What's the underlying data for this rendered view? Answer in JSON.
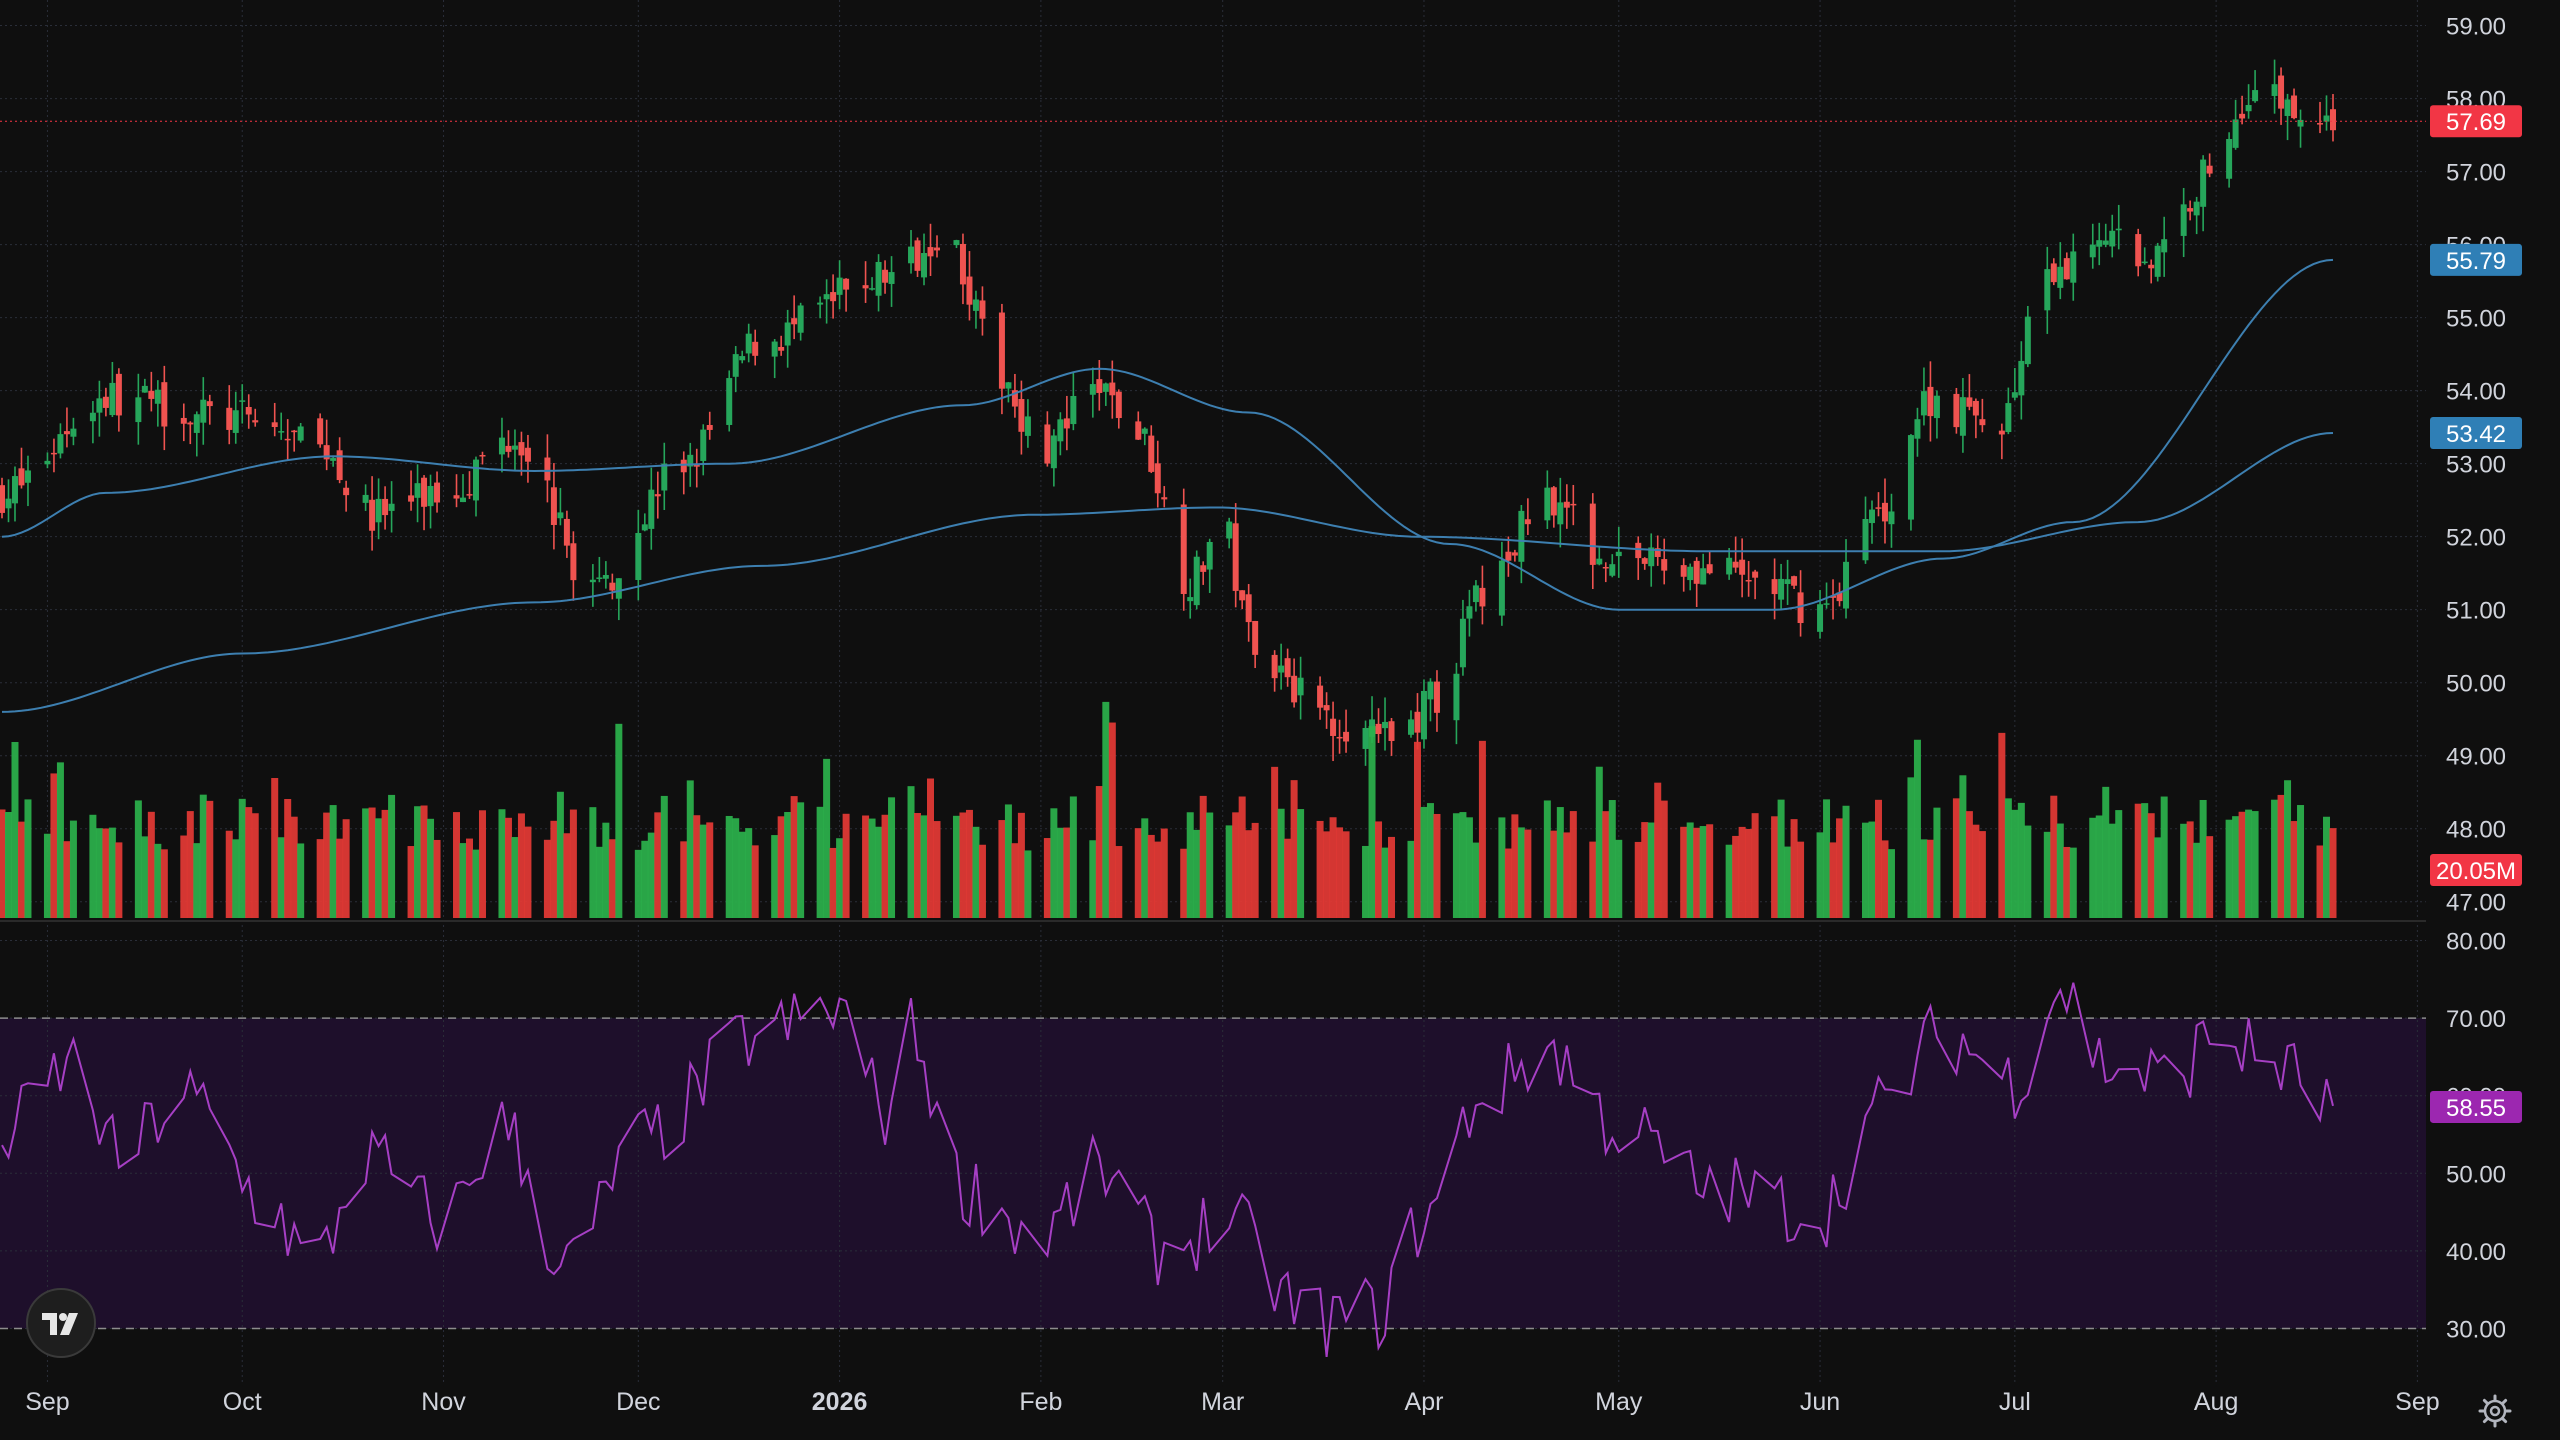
{
  "colors": {
    "background": "#0f0f0f",
    "grid": "#2a2e39",
    "up": "#26a65b",
    "down": "#ef5350",
    "upVolume": "#2bb24c",
    "downVolume": "#e53935",
    "ma": "#3d7fb0",
    "rsi": "#a63fc4",
    "rsiBand": "#1e0f2b",
    "lastPrice": "#f23645",
    "maLabel": "#2f7fb6",
    "rsiLabel": "#9c27b0"
  },
  "icons": {
    "logo": "tradingview-logo-icon",
    "settings": "gear-icon"
  },
  "chart_data": {
    "type": "candlestick",
    "priceAxis": {
      "ticks": [
        "59.00",
        "58.00",
        "57.00",
        "56.00",
        "55.00",
        "54.00",
        "53.00",
        "52.00",
        "51.00",
        "50.00",
        "49.00",
        "48.00",
        "47.00"
      ],
      "range": [
        46.75,
        59.35
      ]
    },
    "rsiAxis": {
      "ticks": [
        "80.00",
        "70.00",
        "60.00",
        "50.00",
        "40.00",
        "30.00"
      ],
      "range": [
        24,
        82
      ],
      "bands": [
        30,
        70
      ]
    },
    "timeAxis": {
      "labels": [
        "Sep",
        "Oct",
        "Nov",
        "Dec",
        "2026",
        "Feb",
        "Mar",
        "Apr",
        "May",
        "Jun",
        "Jul",
        "Aug",
        "Sep"
      ],
      "boldLabel": "2026"
    },
    "priceLabels": {
      "last": "57.69",
      "ma50": "55.79",
      "ma200": "53.42",
      "volume": "20.05M",
      "rsi": "58.55"
    },
    "lastPrice": 57.69,
    "volumeRange": [
      0,
      40
    ],
    "keyPoints": [
      [
        "2025-08-25",
        52.6
      ],
      [
        "2025-09-10",
        53.9
      ],
      [
        "2025-10-01",
        53.6
      ],
      [
        "2025-10-14",
        53.2
      ],
      [
        "2025-10-20",
        52.3
      ],
      [
        "2025-11-01",
        52.6
      ],
      [
        "2025-11-12",
        53.4
      ],
      [
        "2025-11-24",
        51.3
      ],
      [
        "2025-12-08",
        53.0
      ],
      [
        "2025-12-20",
        54.7
      ],
      [
        "2026-01-09",
        55.6
      ],
      [
        "2026-01-17",
        56.2
      ],
      [
        "2026-01-26",
        54.2
      ],
      [
        "2026-02-01",
        53.2
      ],
      [
        "2026-02-10",
        54.0
      ],
      [
        "2026-02-16",
        53.4
      ],
      [
        "2026-02-24",
        51.4
      ],
      [
        "2026-03-01",
        52.2
      ],
      [
        "2026-03-05",
        50.7
      ],
      [
        "2026-03-10",
        50.2
      ],
      [
        "2026-03-15",
        49.6
      ],
      [
        "2026-03-27",
        49.2
      ],
      [
        "2026-04-03",
        49.8
      ],
      [
        "2026-04-10",
        51.2
      ],
      [
        "2026-04-20",
        52.6
      ],
      [
        "2026-04-28",
        51.8
      ],
      [
        "2026-05-10",
        51.6
      ],
      [
        "2026-05-22",
        51.4
      ],
      [
        "2026-06-01",
        51.0
      ],
      [
        "2026-06-10",
        52.3
      ],
      [
        "2026-06-18",
        53.9
      ],
      [
        "2026-06-28",
        53.5
      ],
      [
        "2026-07-06",
        55.4
      ],
      [
        "2026-07-14",
        56.2
      ],
      [
        "2026-07-22",
        55.8
      ],
      [
        "2026-08-01",
        57.1
      ],
      [
        "2026-08-06",
        58.1
      ],
      [
        "2026-08-19",
        57.69
      ]
    ],
    "ma50Points": [
      [
        "2025-08-25",
        52.0
      ],
      [
        "2025-09-10",
        52.6
      ],
      [
        "2025-10-15",
        53.1
      ],
      [
        "2025-11-15",
        52.9
      ],
      [
        "2025-12-15",
        53.0
      ],
      [
        "2026-01-20",
        53.8
      ],
      [
        "2026-02-10",
        54.3
      ],
      [
        "2026-03-05",
        53.7
      ],
      [
        "2026-04-05",
        51.9
      ],
      [
        "2026-05-01",
        51.0
      ],
      [
        "2026-05-25",
        51.0
      ],
      [
        "2026-06-20",
        51.7
      ],
      [
        "2026-07-10",
        52.2
      ],
      [
        "2026-08-19",
        55.79
      ]
    ],
    "ma200Points": [
      [
        "2025-08-25",
        49.6
      ],
      [
        "2025-10-01",
        50.4
      ],
      [
        "2025-11-15",
        51.1
      ],
      [
        "2025-12-20",
        51.6
      ],
      [
        "2026-01-31",
        52.3
      ],
      [
        "2026-02-28",
        52.4
      ],
      [
        "2026-03-31",
        52.0
      ],
      [
        "2026-05-15",
        51.8
      ],
      [
        "2026-06-20",
        51.8
      ],
      [
        "2026-07-20",
        52.2
      ],
      [
        "2026-08-19",
        53.42
      ]
    ],
    "rsiPoints": [
      [
        "2025-08-25",
        55
      ],
      [
        "2025-09-05",
        64
      ],
      [
        "2025-09-12",
        52
      ],
      [
        "2025-09-22",
        60
      ],
      [
        "2025-10-05",
        46
      ],
      [
        "2025-10-12",
        38
      ],
      [
        "2025-10-20",
        52
      ],
      [
        "2025-11-01",
        44
      ],
      [
        "2025-11-10",
        56
      ],
      [
        "2025-11-20",
        38
      ],
      [
        "2025-12-01",
        54
      ],
      [
        "2025-12-20",
        68
      ],
      [
        "2026-01-01",
        71
      ],
      [
        "2026-01-08",
        58
      ],
      [
        "2026-01-12",
        68
      ],
      [
        "2026-01-20",
        48
      ],
      [
        "2026-02-01",
        42
      ],
      [
        "2026-02-10",
        50
      ],
      [
        "2026-02-20",
        40
      ],
      [
        "2026-03-01",
        44
      ],
      [
        "2026-03-15",
        31
      ],
      [
        "2026-03-25",
        32
      ],
      [
        "2026-04-01",
        44
      ],
      [
        "2026-04-10",
        60
      ],
      [
        "2026-04-20",
        66
      ],
      [
        "2026-05-01",
        56
      ],
      [
        "2026-05-15",
        48
      ],
      [
        "2026-06-01",
        45
      ],
      [
        "2026-06-10",
        58
      ],
      [
        "2026-06-20",
        68
      ],
      [
        "2026-07-01",
        62
      ],
      [
        "2026-07-08",
        74
      ],
      [
        "2026-07-15",
        64
      ],
      [
        "2026-07-25",
        62
      ],
      [
        "2026-08-01",
        68
      ],
      [
        "2026-08-10",
        64
      ],
      [
        "2026-08-19",
        58.55
      ]
    ]
  }
}
